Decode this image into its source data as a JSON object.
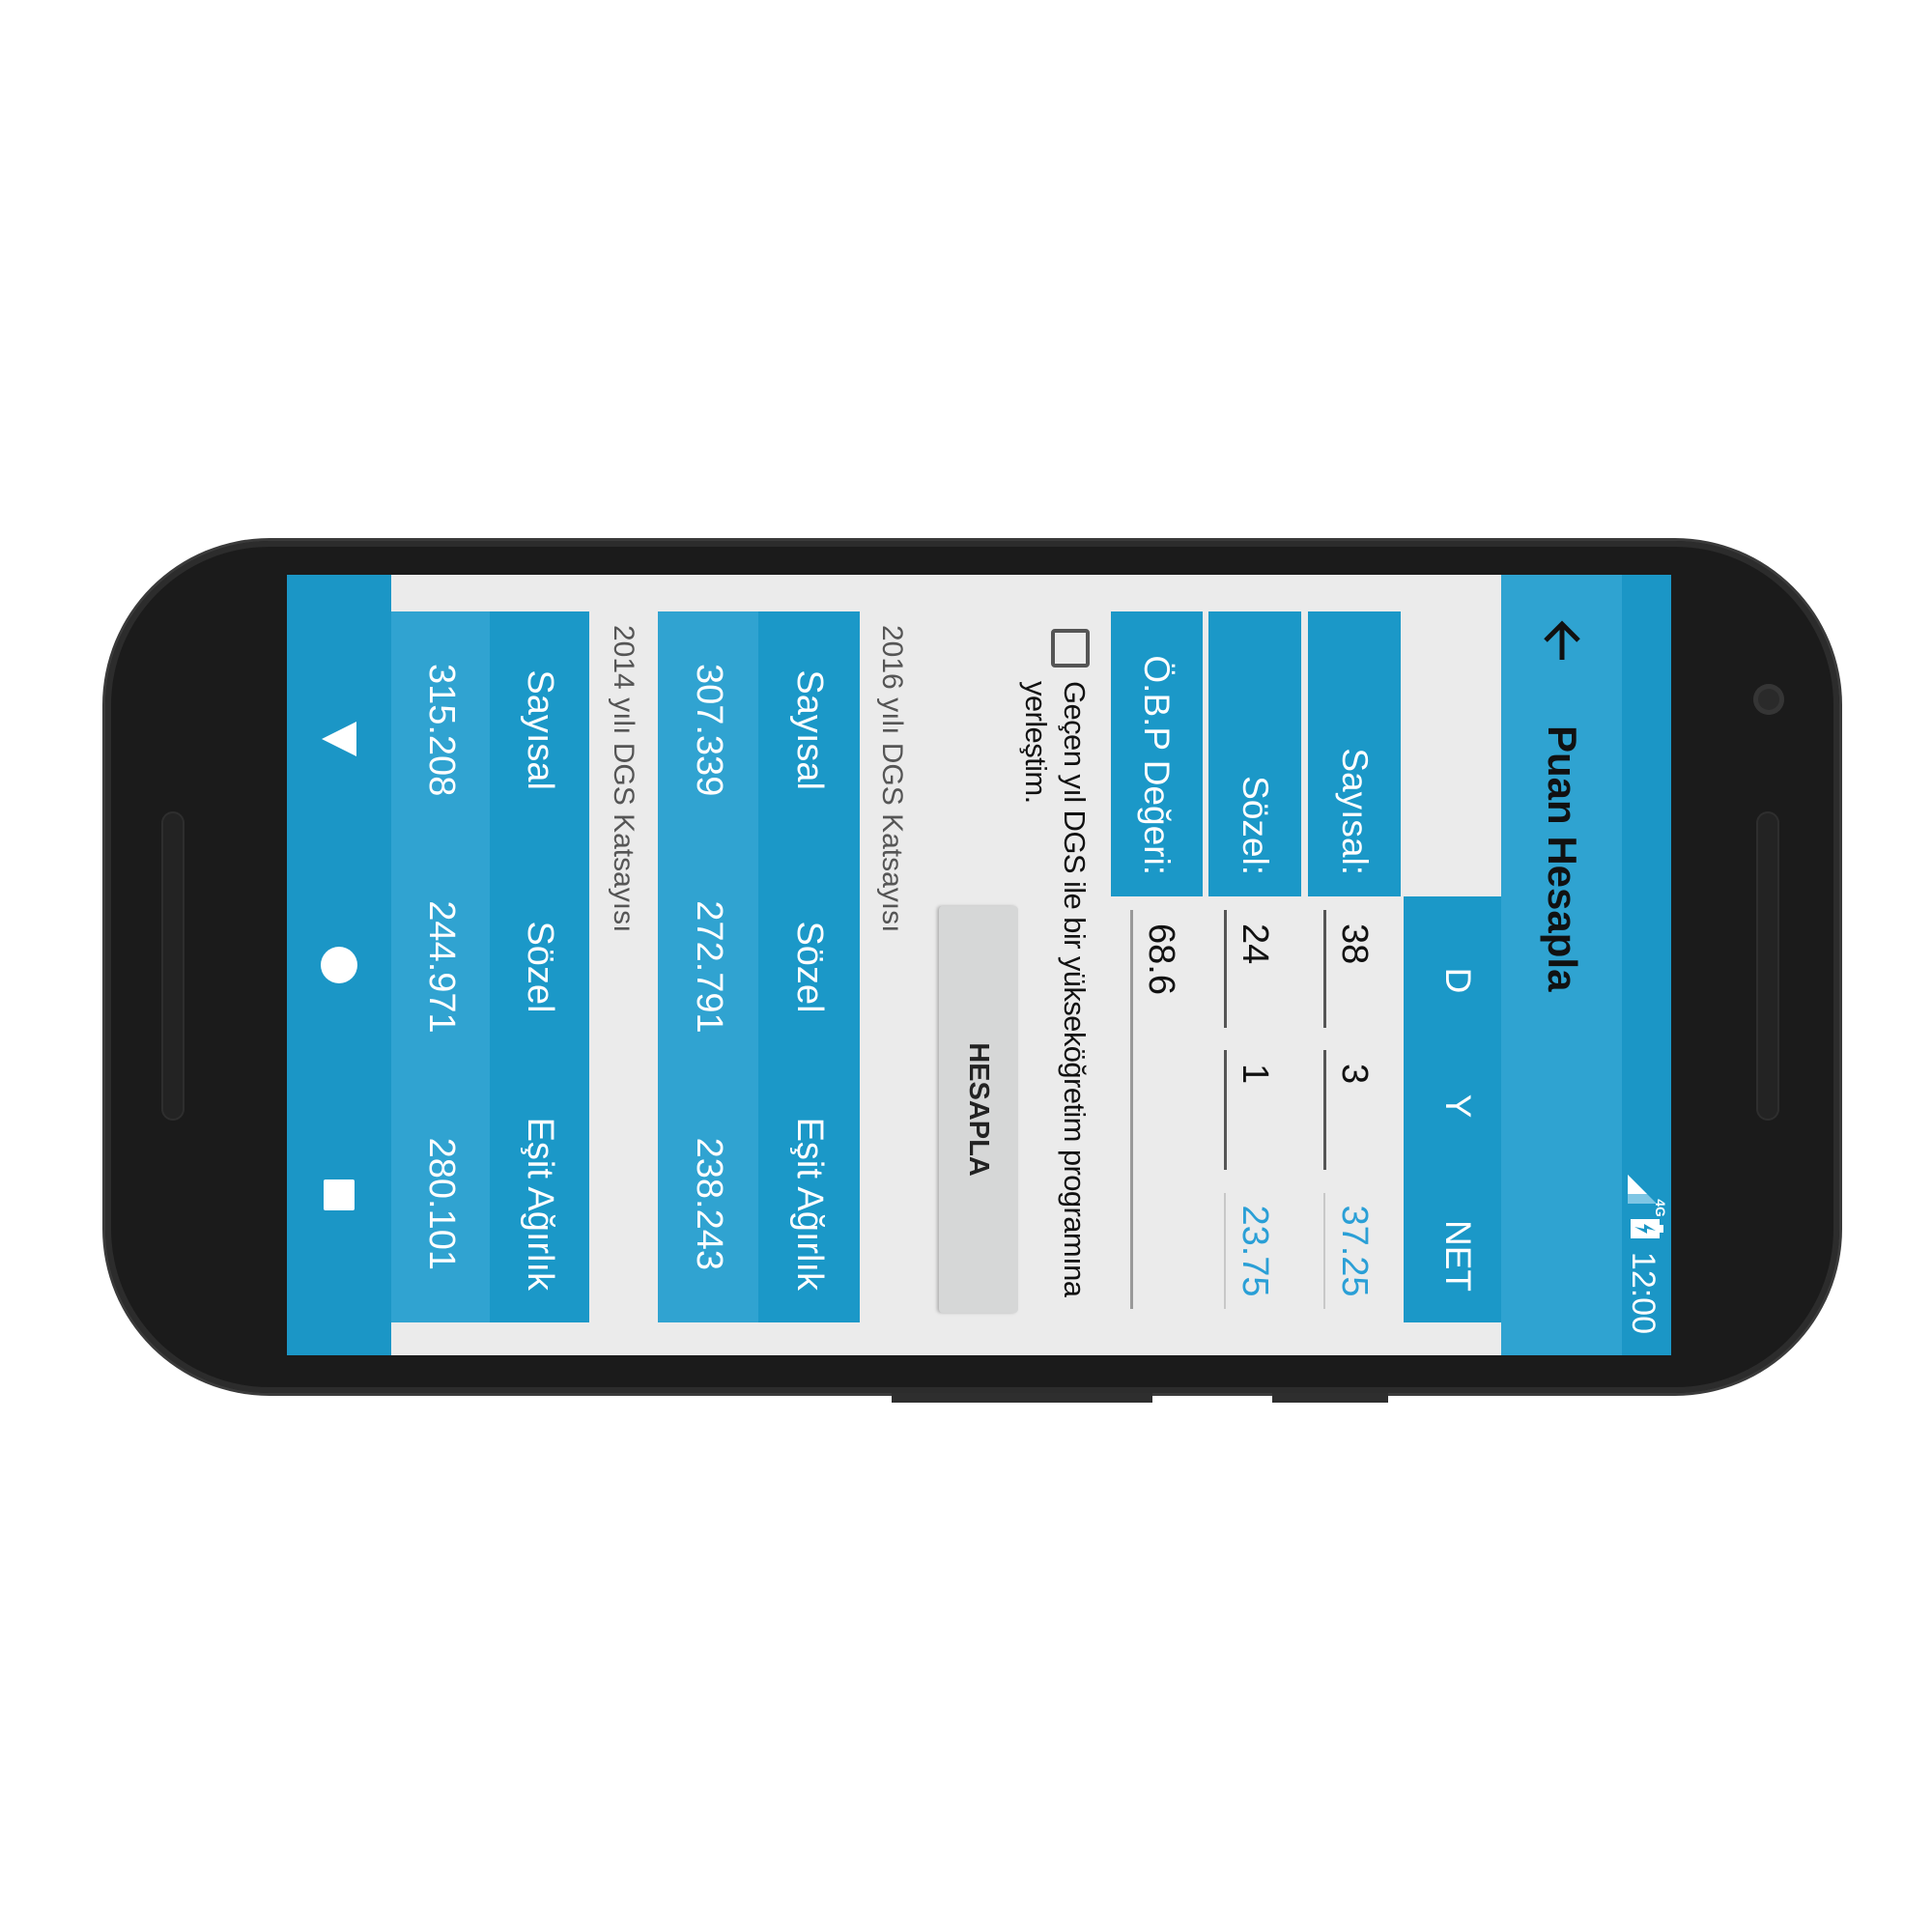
{
  "status_bar": {
    "network": "4G",
    "time": "12:00",
    "icons": [
      "signal-icon",
      "battery-charging-icon"
    ]
  },
  "toolbar": {
    "title": "Puan Hesapla",
    "back_icon": "arrow-back-icon"
  },
  "score_table": {
    "columns": [
      "D",
      "Y",
      "NET"
    ],
    "rows": [
      {
        "label": "Sayısal:",
        "d": "38",
        "y": "3",
        "net": "37.25"
      },
      {
        "label": "Sözel:",
        "d": "24",
        "y": "1",
        "net": "23.75"
      }
    ],
    "obp": {
      "label": "Ö.B.P Değeri:",
      "value": "68.6"
    }
  },
  "checkbox": {
    "label": "Geçen yıl DGS ile bir yükseköğretim programına yerleştim.",
    "checked": false
  },
  "calculate_button": "HESAPLA",
  "coefficients": [
    {
      "title": "2016 yılı DGS Katsayısı",
      "headers": [
        "Sayısal",
        "Sözel",
        "Eşit Ağırlık"
      ],
      "values": [
        "307.339",
        "272.791",
        "238.243"
      ]
    },
    {
      "title": "2014 yılı DGS Katsayısı",
      "headers": [
        "Sayısal",
        "Sözel",
        "Eşit Ağırlık"
      ],
      "values": [
        "315.208",
        "244.971",
        "280.101"
      ]
    }
  ],
  "nav_bar": {
    "icons": [
      "back-triangle-icon",
      "home-circle-icon",
      "recents-square-icon"
    ]
  },
  "colors": {
    "primary": "#2fa3d1",
    "primary_dark": "#1b96c6",
    "cell": "#1b98c8",
    "net_text": "#2a9fd6",
    "background": "#ebebeb"
  }
}
